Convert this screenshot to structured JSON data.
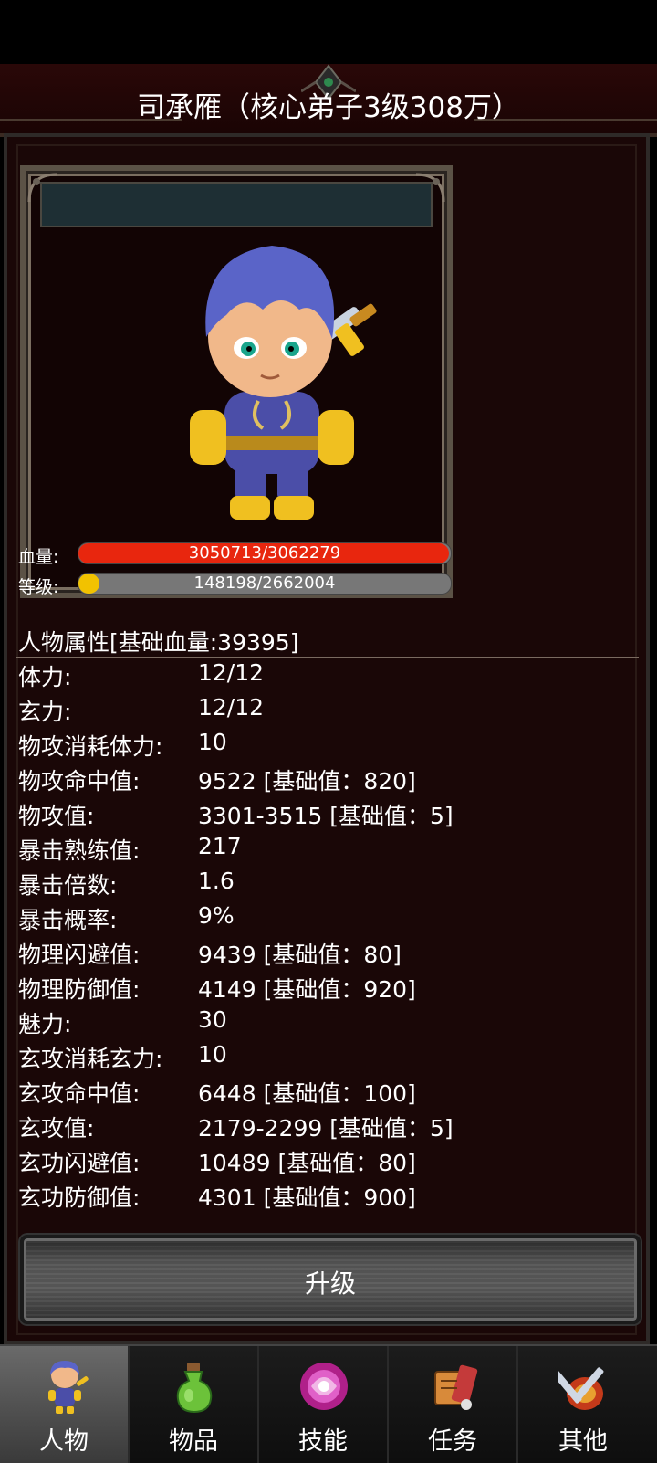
{
  "header": {
    "title": "司承雁（核心弟子3级308万）"
  },
  "stats_bars": {
    "hp": {
      "label": "血量:",
      "text": "3050713/3062279",
      "fraction": 0.9962,
      "color": "#e8260e"
    },
    "level": {
      "label": "等级:",
      "text": "148198/2662004",
      "fraction": 0.0557,
      "color": "#f2c200"
    }
  },
  "attributes": {
    "header": "人物属性[基础血量:39395]",
    "rows": [
      {
        "label": "体力:",
        "value": "12/12"
      },
      {
        "label": "玄力:",
        "value": "12/12"
      },
      {
        "label": "物攻消耗体力:",
        "value": "10"
      },
      {
        "label": "物攻命中值:",
        "value": "9522 [基础值：820]"
      },
      {
        "label": "物攻值:",
        "value": "3301-3515 [基础值：5]"
      },
      {
        "label": "暴击熟练值:",
        "value": "217"
      },
      {
        "label": "暴击倍数:",
        "value": "1.6"
      },
      {
        "label": "暴击概率:",
        "value": "9%"
      },
      {
        "label": "物理闪避值:",
        "value": "9439 [基础值：80]"
      },
      {
        "label": "物理防御值:",
        "value": "4149 [基础值：920]"
      },
      {
        "label": "魅力:",
        "value": "30"
      },
      {
        "label": "玄攻消耗玄力:",
        "value": "10"
      },
      {
        "label": "玄攻命中值:",
        "value": "6448 [基础值：100]"
      },
      {
        "label": "玄攻值:",
        "value": "2179-2299 [基础值：5]"
      },
      {
        "label": "玄功闪避值:",
        "value": "10489 [基础值：80]"
      },
      {
        "label": "玄功防御值:",
        "value": "4301 [基础值：900]"
      }
    ]
  },
  "actions": {
    "upgrade_label": "升级"
  },
  "tabs": [
    {
      "label": "人物",
      "icon": "character-icon",
      "active": true
    },
    {
      "label": "物品",
      "icon": "potion-icon",
      "active": false
    },
    {
      "label": "技能",
      "icon": "skill-orb-icon",
      "active": false
    },
    {
      "label": "任务",
      "icon": "quest-icon",
      "active": false
    },
    {
      "label": "其他",
      "icon": "sword-shield-icon",
      "active": false
    }
  ]
}
